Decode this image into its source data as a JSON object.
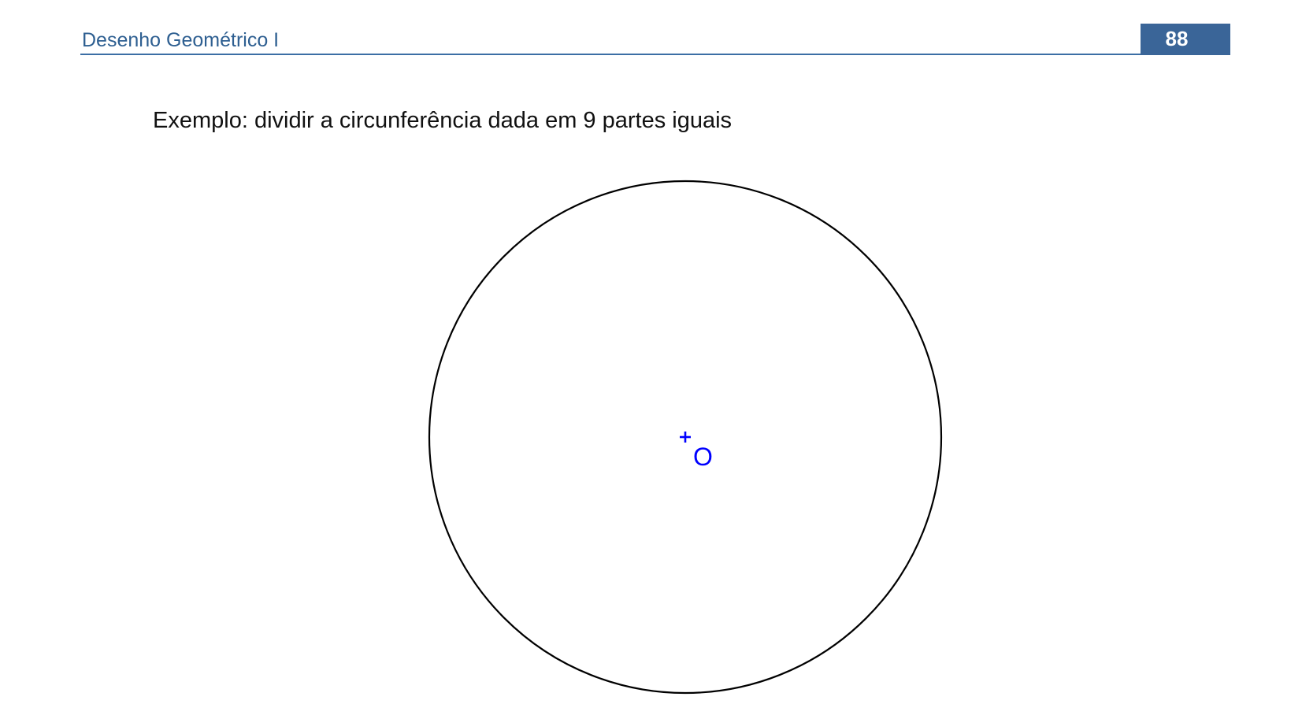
{
  "header": {
    "title": "Desenho Geométrico I",
    "page_number": "88",
    "accent_color": "#3a6598"
  },
  "content": {
    "example_text": "Exemplo: dividir a circunferência dada em 9 partes iguais"
  },
  "figure": {
    "center_label": "O",
    "circle_color": "#000000",
    "center_color": "#0000ff"
  }
}
